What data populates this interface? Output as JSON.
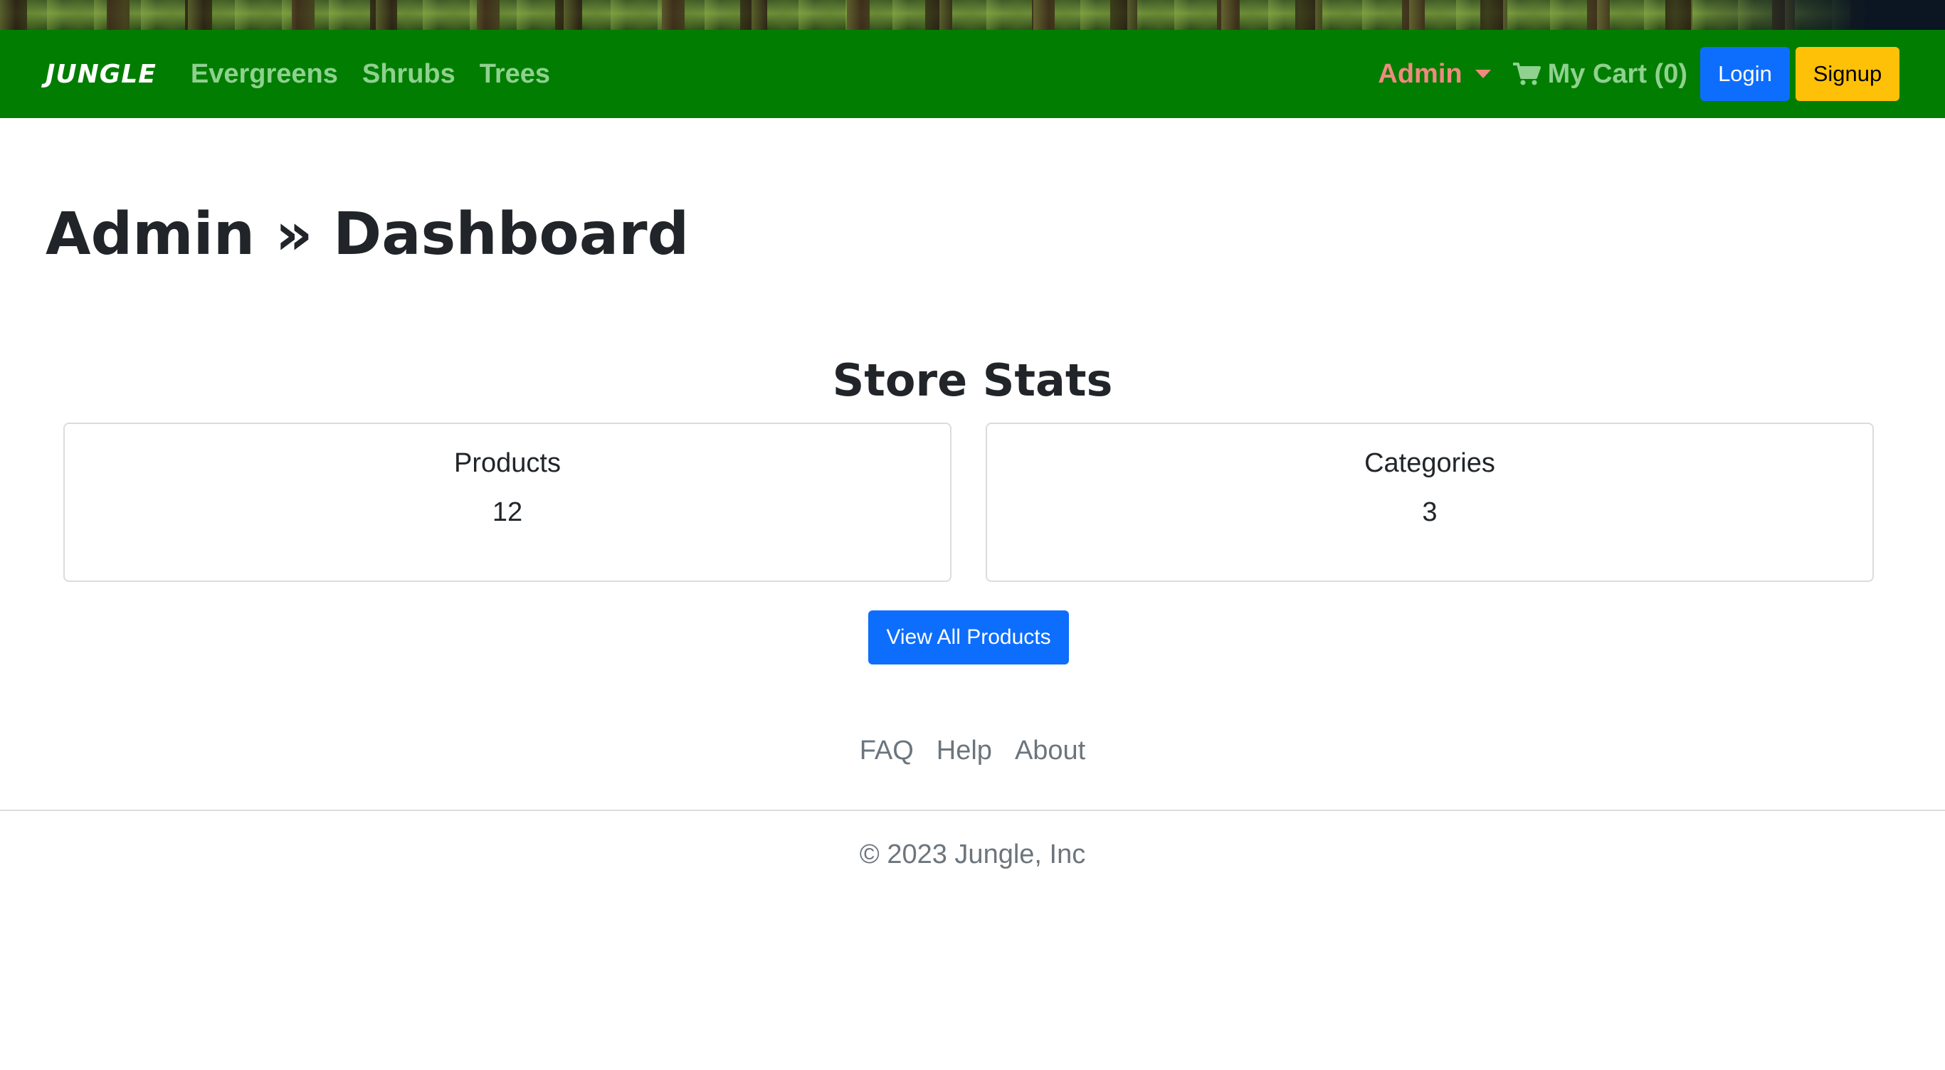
{
  "navbar": {
    "brand": "JUNGLE",
    "links": [
      "Evergreens",
      "Shrubs",
      "Trees"
    ],
    "admin_label": "Admin",
    "cart_label": "My Cart (0)",
    "login_label": "Login",
    "signup_label": "Signup",
    "background_color": "#017e01"
  },
  "page": {
    "title": "Admin » Dashboard"
  },
  "stats": {
    "heading": "Store Stats",
    "products": {
      "label": "Products",
      "value": "12"
    },
    "categories": {
      "label": "Categories",
      "value": "3"
    },
    "view_all_label": "View All Products"
  },
  "footer": {
    "links": [
      "FAQ",
      "Help",
      "About"
    ],
    "copyright": "© 2023 Jungle, Inc"
  },
  "icons": {
    "cart": "shopping-cart-icon",
    "admin_caret": "caret-down-icon"
  }
}
